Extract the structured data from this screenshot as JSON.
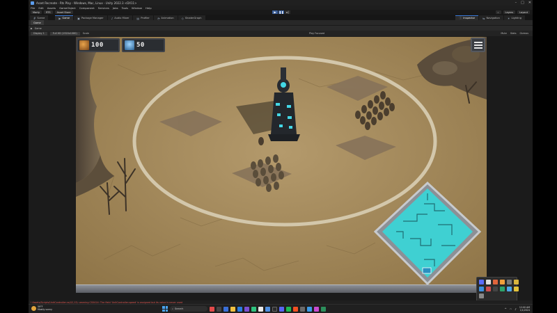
{
  "window": {
    "title": "Asset Recreate - Rts Play - Windows, Mac, Linux - Unity 2022.3 <DX11>"
  },
  "menu": [
    "File",
    "Edit",
    "Assets",
    "GameObject",
    "Component",
    "Services",
    "Jobs",
    "Tools",
    "Window",
    "Help"
  ],
  "toolbar": {
    "account": "Marty",
    "cloud": "RTS",
    "asset_store": "Asset Store",
    "layers": "Layers",
    "layout": "Layout"
  },
  "tabs": [
    {
      "label": "Scene",
      "icon": "#"
    },
    {
      "label": "Game",
      "icon": "▶"
    },
    {
      "label": "Package Manager",
      "icon": "▣"
    },
    {
      "label": "Audio Mixer",
      "icon": "♪"
    },
    {
      "label": "Profiler",
      "icon": "▤"
    },
    {
      "label": "Animation",
      "icon": "◔"
    },
    {
      "label": "ShaderGraph",
      "icon": "◇"
    },
    {
      "label": "Inspector",
      "icon": "ⓘ"
    },
    {
      "label": "Navigation",
      "icon": "⇆"
    },
    {
      "label": "Lighting",
      "icon": "☀"
    }
  ],
  "game_view": {
    "tab": "Game",
    "display": "Display 1",
    "resolution": "Full HD (1920x1080)",
    "scale": "Scale",
    "play_focused": "Play Focused",
    "stats": "Stats",
    "gizmos": "Gizmos",
    "mute": "Mute"
  },
  "hud": {
    "gold": "100",
    "energy": "50",
    "gold_icon": "ore-crystal-icon",
    "energy_icon": "energy-crystal-icon",
    "menu_icon": "hamburger-menu-icon"
  },
  "console_message": "!  Assets/Scripts/UnitController.cs(42,13): warning CS0414: The field 'UnitController.speed' is assigned but its value is never used",
  "taskbar": {
    "temp": "59°F",
    "condition": "Mostly sunny",
    "search": "Search",
    "time": "12:00 AM",
    "date": "1/1/2024"
  },
  "colors": {
    "ground": "#a88d60",
    "ring": "#cfc3a7",
    "tower_glow": "#43d7e6",
    "minimap": "#3fd0d2",
    "editor_bg": "#1b1b1b",
    "active_tab": "#3a79d8"
  }
}
